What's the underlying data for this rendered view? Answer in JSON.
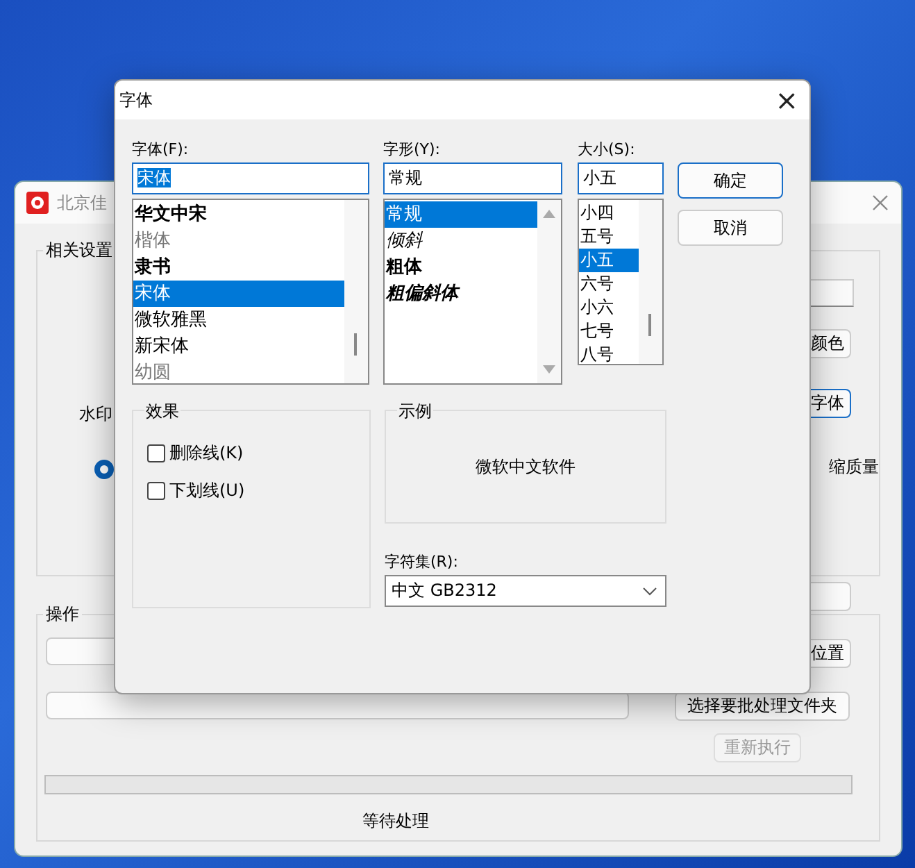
{
  "background_window": {
    "title": "北京佳",
    "settings_group": "相关设置",
    "label_b": "水印",
    "radio": {
      "selected": true
    },
    "color_button": "颜色",
    "font_button": "字体",
    "quality_label": "缩质量",
    "progress": {
      "level": 0
    },
    "operations_group": "操作",
    "position_button": "位置",
    "folder_button": "选择要批处理文件夹",
    "rerun_button": {
      "label": "重新执行",
      "disabled": true
    },
    "status": "等待处理"
  },
  "dialog": {
    "title": "字体",
    "close": "×",
    "font": {
      "label": "字体(F):",
      "value": "宋体",
      "items": [
        {
          "label": "华文中宋",
          "kind": "bold",
          "selected": false
        },
        {
          "label": "楷体",
          "kind": "grey",
          "selected": false
        },
        {
          "label": "隶书",
          "kind": "bold",
          "selected": false
        },
        {
          "label": "宋体",
          "kind": "normal",
          "selected": true
        },
        {
          "label": "微软雅黑",
          "kind": "normal",
          "selected": false
        },
        {
          "label": "新宋体",
          "kind": "normal",
          "selected": false
        },
        {
          "label": "幼圆",
          "kind": "grey",
          "selected": false
        }
      ]
    },
    "style": {
      "label": "字形(Y):",
      "value": "常规",
      "items": [
        {
          "label": "常规",
          "kind": "normal",
          "selected": true
        },
        {
          "label": "倾斜",
          "kind": "italic",
          "selected": false
        },
        {
          "label": "粗体",
          "kind": "bold",
          "selected": false
        },
        {
          "label": "粗偏斜体",
          "kind": "bolditalic",
          "selected": false
        }
      ]
    },
    "size": {
      "label": "大小(S):",
      "value": "小五",
      "items": [
        {
          "label": "小四",
          "selected": false
        },
        {
          "label": "五号",
          "selected": false
        },
        {
          "label": "小五",
          "selected": true
        },
        {
          "label": "六号",
          "selected": false
        },
        {
          "label": "小六",
          "selected": false
        },
        {
          "label": "七号",
          "selected": false
        },
        {
          "label": "八号",
          "selected": false
        }
      ]
    },
    "ok": "确定",
    "cancel": "取消",
    "effects": {
      "title": "效果",
      "options": [
        {
          "label": "删除线(K)",
          "checked": false
        },
        {
          "label": "下划线(U)",
          "checked": false
        }
      ]
    },
    "sample": {
      "title": "示例",
      "text": "微软中文软件"
    },
    "charset": {
      "label": "字符集(R):",
      "value": "中文 GB2312"
    }
  }
}
